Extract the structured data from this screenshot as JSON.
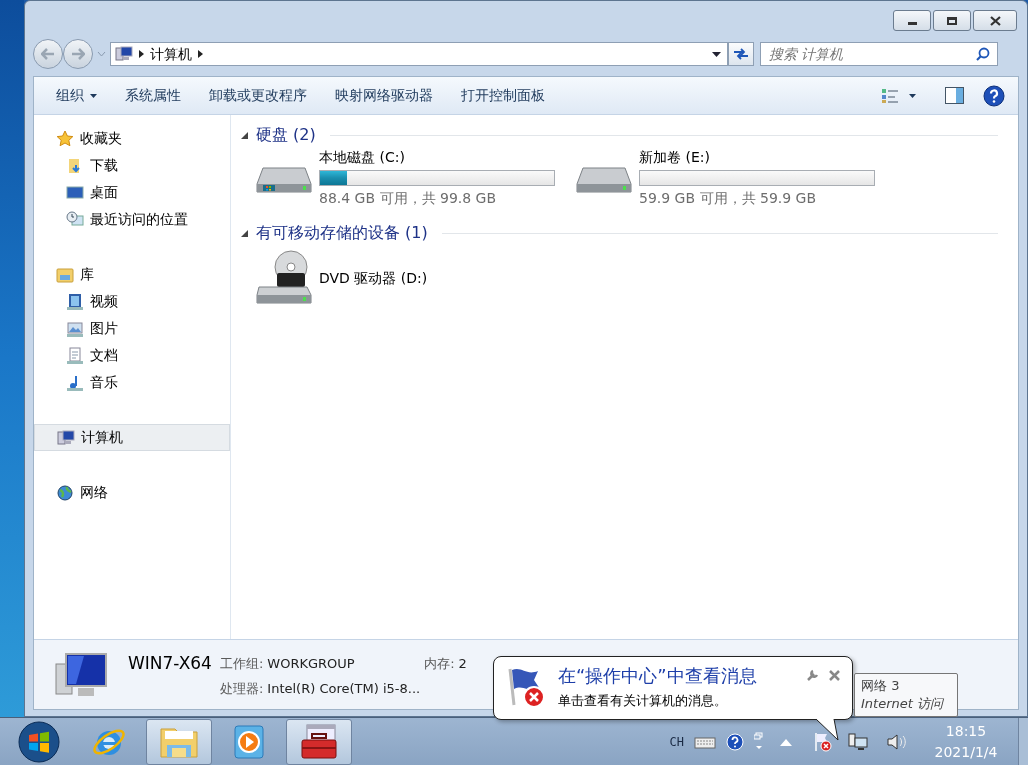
{
  "window": {
    "controls": [
      {
        "kind": "minimize"
      },
      {
        "kind": "maximize"
      },
      {
        "kind": "close"
      }
    ]
  },
  "address": {
    "path": [
      "计算机"
    ]
  },
  "search": {
    "placeholder": "搜索 计算机"
  },
  "toolbar": [
    {
      "label": "组织",
      "dropdown": true
    },
    {
      "label": "系统属性",
      "dropdown": false
    },
    {
      "label": "卸载或更改程序",
      "dropdown": false
    },
    {
      "label": "映射网络驱动器",
      "dropdown": false
    },
    {
      "label": "打开控制面板",
      "dropdown": false
    }
  ],
  "nav": [
    {
      "label": "收藏夹",
      "kind": "star",
      "selected": false,
      "children": [
        {
          "label": "下载",
          "kind": "download",
          "selected": false
        },
        {
          "label": "桌面",
          "kind": "desktop",
          "selected": false
        },
        {
          "label": "最近访问的位置",
          "kind": "recent",
          "selected": false
        }
      ]
    },
    {
      "label": "库",
      "kind": "library",
      "selected": false,
      "children": [
        {
          "label": "视频",
          "kind": "video",
          "selected": false
        },
        {
          "label": "图片",
          "kind": "picture",
          "selected": false
        },
        {
          "label": "文档",
          "kind": "document",
          "selected": false
        },
        {
          "label": "音乐",
          "kind": "music",
          "selected": false
        }
      ]
    },
    {
      "label": "计算机",
      "kind": "computer",
      "selected": true
    },
    {
      "label": "网络",
      "kind": "network",
      "selected": false
    }
  ],
  "groups": [
    {
      "title": "硬盘 (2)",
      "expanded": true,
      "items": [
        {
          "name": "本地磁盘 (C:)",
          "kind": "system_disk",
          "level": 0.114,
          "reading": "88.4 GB 可用，共 99.8 GB"
        },
        {
          "name": "新加卷 (E:)",
          "kind": "disk",
          "level": 0,
          "reading": "59.9 GB 可用，共 59.9 GB"
        }
      ]
    },
    {
      "title": "有可移动存储的设备 (1)",
      "expanded": true,
      "items": [
        {
          "name": "DVD 驱动器 (D:)",
          "kind": "dvd"
        }
      ]
    }
  ],
  "details": {
    "name": "WIN7-X64",
    "fields": [
      {
        "label": "工作组:",
        "value": "WORKGROUP"
      },
      {
        "label": "内存:",
        "value": "2"
      },
      {
        "label": "处理器:",
        "value": "Intel(R) Core(TM) i5-8..."
      }
    ]
  },
  "taskbar": {
    "apps": [
      {
        "kind": "ie",
        "selected": false
      },
      {
        "kind": "explorer",
        "selected": true
      },
      {
        "kind": "media",
        "selected": false
      },
      {
        "kind": "toolbox",
        "selected": true
      }
    ],
    "language": "CH",
    "time": "18:15",
    "date": "2021/1/4"
  },
  "balloon": {
    "title": "在“操作中心”中查看消息",
    "body": "单击查看有关计算机的消息。"
  },
  "tooltip": {
    "title": "网络 3",
    "subtitle": "Internet 访问"
  }
}
